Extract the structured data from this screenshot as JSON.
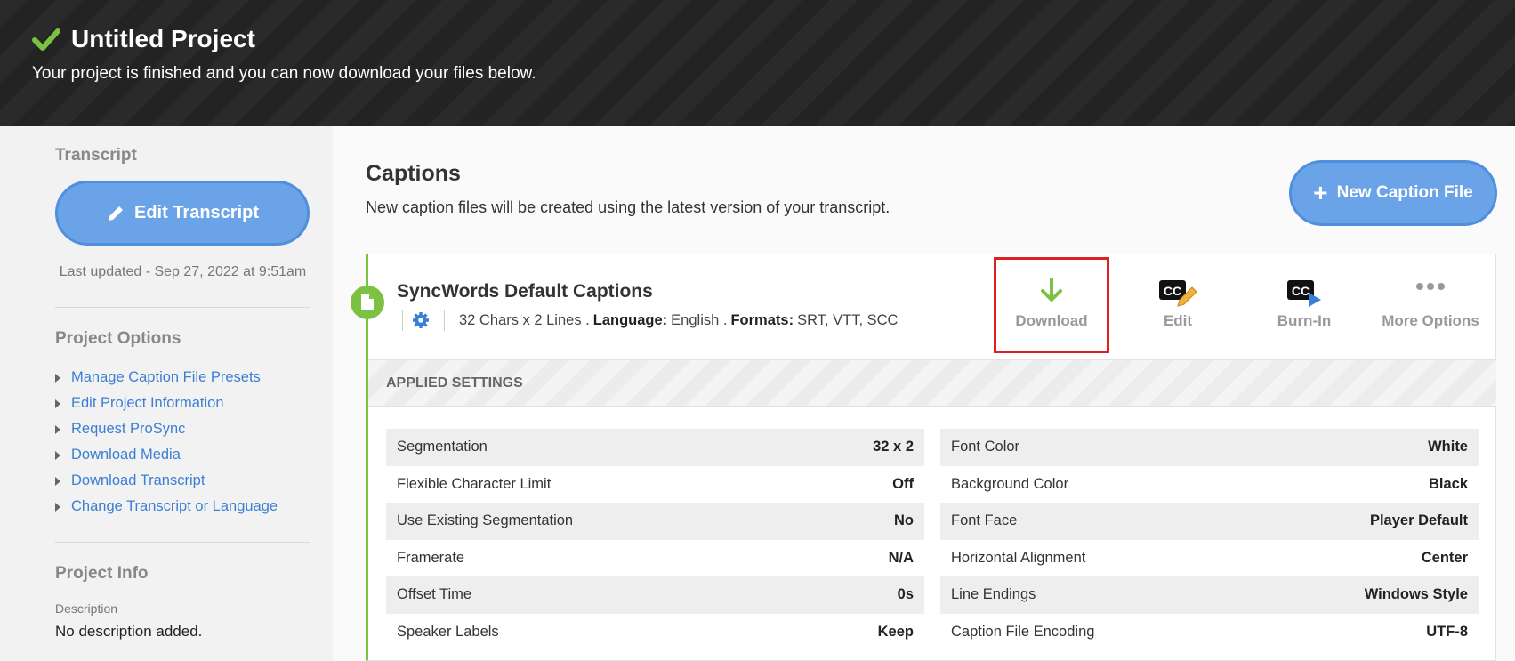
{
  "header": {
    "title": "Untitled Project",
    "subtitle": "Your project is finished and you can now download your files below."
  },
  "sidebar": {
    "transcript_title": "Transcript",
    "edit_transcript_label": "Edit Transcript",
    "last_updated": "Last updated - Sep 27, 2022 at 9:51am",
    "options_title": "Project Options",
    "options": [
      "Manage Caption File Presets",
      "Edit Project Information",
      "Request ProSync",
      "Download Media",
      "Download Transcript",
      "Change Transcript or Language"
    ],
    "info_title": "Project Info",
    "description_label": "Description",
    "description_value": "No description added."
  },
  "main": {
    "title": "Captions",
    "subtitle": "New caption files will be created using the latest version of your transcript.",
    "new_caption_label": "New Caption File"
  },
  "card": {
    "title": "SyncWords Default Captions",
    "meta_prefix": "32 Chars x 2 Lines .",
    "language_label": "Language:",
    "language_value": "English .",
    "formats_label": "Formats:",
    "formats_value": "SRT, VTT, SCC",
    "actions": {
      "download": "Download",
      "edit": "Edit",
      "burn_in": "Burn-In",
      "more_options": "More Options"
    },
    "applied_settings": "APPLIED SETTINGS",
    "left_settings": [
      {
        "label": "Segmentation",
        "value": "32 x 2"
      },
      {
        "label": "Flexible Character Limit",
        "value": "Off"
      },
      {
        "label": "Use Existing Segmentation",
        "value": "No"
      },
      {
        "label": "Framerate",
        "value": "N/A"
      },
      {
        "label": "Offset Time",
        "value": "0s"
      },
      {
        "label": "Speaker Labels",
        "value": "Keep"
      }
    ],
    "right_settings": [
      {
        "label": "Font Color",
        "value": "White"
      },
      {
        "label": "Background Color",
        "value": "Black"
      },
      {
        "label": "Font Face",
        "value": "Player Default"
      },
      {
        "label": "Horizontal Alignment",
        "value": "Center"
      },
      {
        "label": "Line Endings",
        "value": "Windows Style"
      },
      {
        "label": "Caption File Encoding",
        "value": "UTF-8"
      }
    ]
  },
  "colors": {
    "accent_blue": "#6aa3e8",
    "success_green": "#7cc242",
    "highlight_red": "#e02020",
    "link_blue": "#3b7fd4"
  }
}
